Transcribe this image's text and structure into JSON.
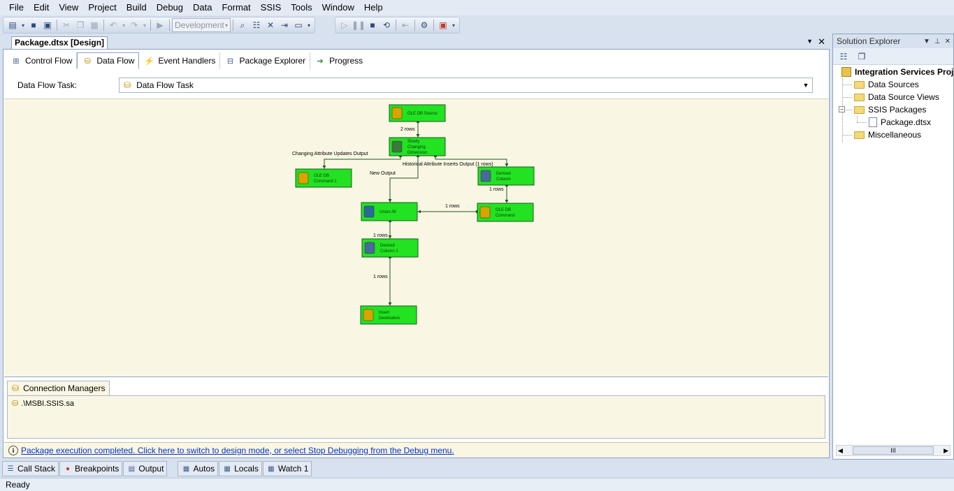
{
  "menu": [
    "File",
    "Edit",
    "View",
    "Project",
    "Build",
    "Debug",
    "Data",
    "Format",
    "SSIS",
    "Tools",
    "Window",
    "Help"
  ],
  "toolbar": {
    "config_value": "Development"
  },
  "document": {
    "tab_title": "Package.dtsx [Design]",
    "designer_tabs": [
      "Control Flow",
      "Data Flow",
      "Event Handlers",
      "Package Explorer",
      "Progress"
    ],
    "active_tab": "Data Flow",
    "task_label": "Data Flow Task:",
    "task_value": "Data Flow Task"
  },
  "dataflow": {
    "components": [
      {
        "id": "ole-db-source",
        "label": [
          "OLE DB Source"
        ]
      },
      {
        "id": "slowly-changing-dimension",
        "label": [
          "Slowly",
          "Changing",
          "Dimension"
        ]
      },
      {
        "id": "ole-db-command-1",
        "label": [
          "OLE DB",
          "Command 1"
        ]
      },
      {
        "id": "derived-column",
        "label": [
          "Derived",
          "Column"
        ]
      },
      {
        "id": "union-all",
        "label": [
          "Union All"
        ]
      },
      {
        "id": "ole-db-command",
        "label": [
          "OLE DB",
          "Command"
        ]
      },
      {
        "id": "derived-column-1",
        "label": [
          "Derived",
          "Column 1"
        ]
      },
      {
        "id": "insert-destination",
        "label": [
          "Insert",
          "Destination"
        ]
      }
    ],
    "paths": [
      {
        "id": "src-to-scd",
        "label": "2 rows"
      },
      {
        "id": "changing-attribute",
        "label": "Changing Attribute Updates Output"
      },
      {
        "id": "new-output",
        "label": "New Output"
      },
      {
        "id": "historical-attribute",
        "label": "Historical Attribute Inserts Output (1 rows)"
      },
      {
        "id": "derived-to-command",
        "label": "1 rows"
      },
      {
        "id": "command-to-union",
        "label": "1 rows"
      },
      {
        "id": "union-to-derived1",
        "label": "1 rows"
      },
      {
        "id": "derived1-to-insert",
        "label": "1 rows"
      }
    ]
  },
  "connection_managers": {
    "tab_label": "Connection Managers",
    "items": [
      ".\\MSBI.SSIS.sa"
    ]
  },
  "status_message": "Package execution completed. Click here to switch to design mode, or select Stop Debugging from the Debug menu.",
  "solution_explorer": {
    "title": "Solution Explorer",
    "project": "Integration Services Project",
    "items": [
      "Data Sources",
      "Data Source Views",
      "SSIS Packages",
      "Package.dtsx",
      "Miscellaneous"
    ]
  },
  "bottom_tabs": [
    "Call Stack",
    "Breakpoints",
    "Output",
    "Autos",
    "Locals",
    "Watch 1"
  ],
  "statusbar": {
    "text": "Ready"
  }
}
